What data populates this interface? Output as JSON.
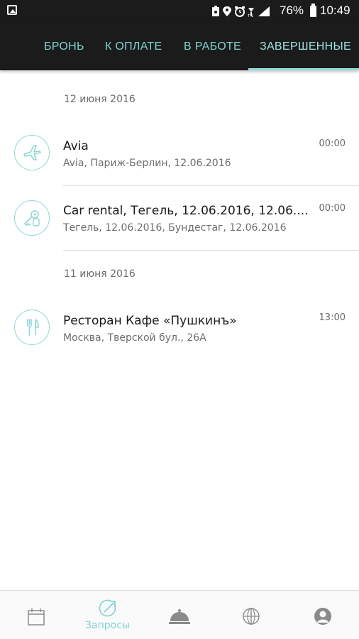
{
  "status_bar": {
    "battery": "76%",
    "time": "10:49",
    "icons": [
      "gallery-icon",
      "lock-badge-icon",
      "location-icon",
      "alarm-icon",
      "data-icon",
      "signal-icon",
      "battery-icon"
    ]
  },
  "tabs": [
    {
      "label": "БРОНЬ",
      "active": false
    },
    {
      "label": "К ОПЛАТЕ",
      "active": false
    },
    {
      "label": "В РАБОТЕ",
      "active": false
    },
    {
      "label": "ЗАВЕРШЕННЫЕ",
      "active": true
    }
  ],
  "groups": [
    {
      "date": "12 июня 2016",
      "items": [
        {
          "icon": "airplane-icon",
          "title": "Avia",
          "subtitle": "Avia, Париж-Берлин, 12.06.2016",
          "time": "00:00"
        },
        {
          "icon": "car-key-icon",
          "title": "Car rental, Тегель, 12.06.2016, 12.06....",
          "subtitle": "Тегель, 12.06.2016, Бундестаг, 12.06.2016",
          "time": "00:00"
        }
      ]
    },
    {
      "date": "11 июня 2016",
      "items": [
        {
          "icon": "fork-knife-icon",
          "title": "Ресторан Кафе «Пушкинъ»",
          "subtitle": "Москва, Тверской бул., 26А",
          "time": "13:00"
        }
      ]
    }
  ],
  "bottom_nav": [
    {
      "icon": "calendar-icon",
      "label": "",
      "active": false
    },
    {
      "icon": "requests-icon",
      "label": "Запросы",
      "active": true
    },
    {
      "icon": "service-bell-icon",
      "label": "",
      "active": false
    },
    {
      "icon": "globe-icon",
      "label": "",
      "active": false
    },
    {
      "icon": "profile-icon",
      "label": "",
      "active": false
    }
  ],
  "colors": {
    "accent": "#7fd3d3",
    "bar_bg": "#1b1b1b",
    "icon_gray": "#8a8a8a"
  }
}
